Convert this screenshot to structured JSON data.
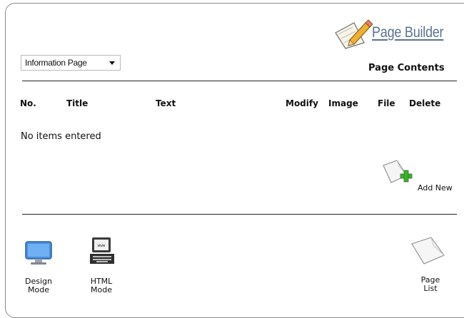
{
  "app": {
    "title": "Page Builder"
  },
  "page_select": {
    "value": "Information Page"
  },
  "section": {
    "title": "Page Contents"
  },
  "table": {
    "columns": [
      "No.",
      "Title",
      "Text",
      "Modify",
      "Image",
      "File",
      "Delete"
    ],
    "empty_message": "No items entered"
  },
  "actions": {
    "add_new": "Add New",
    "design_mode": {
      "line1": "Design",
      "line2": "Mode"
    },
    "html_mode": {
      "line1": "HTML",
      "line2": "Mode"
    },
    "page_list": {
      "line1": "Page",
      "line2": "List"
    }
  }
}
